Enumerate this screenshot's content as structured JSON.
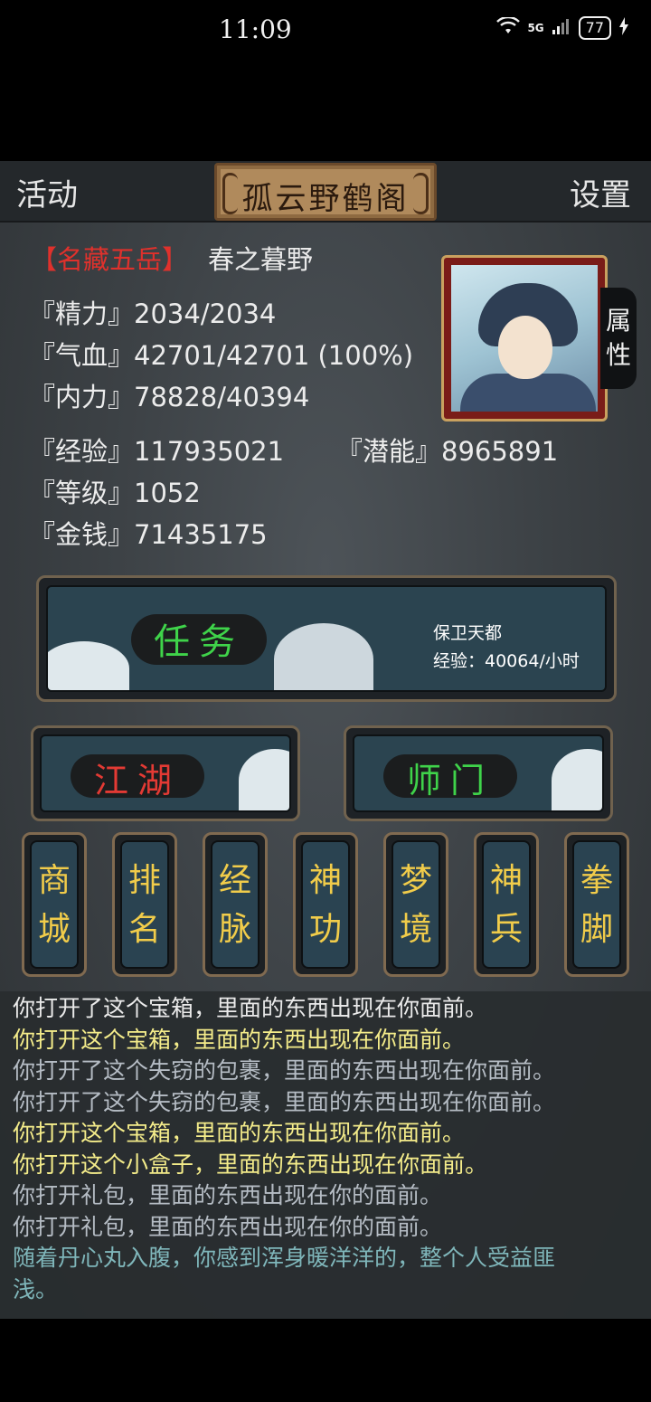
{
  "status_bar": {
    "time": "11:09",
    "network": "5G",
    "battery": "77"
  },
  "topbar": {
    "left_label": "活动",
    "title": "孤云野鹤阁",
    "right_label": "设置"
  },
  "character": {
    "title_tag": "【名藏五岳】",
    "name": "春之暮野",
    "attr_tab": [
      "属",
      "性"
    ]
  },
  "stats": {
    "jingli": "『精力』2034/2034",
    "qixue": "『气血』42701/42701 (100%)",
    "neili": "『内力』78828/40394",
    "jingyan": "『经验』117935021",
    "qianneng": "『潜能』8965891",
    "dengji": "『等级』1052",
    "jinqian": "『金钱』71435175"
  },
  "quest": {
    "label": "任务",
    "info_line1": "保卫天都",
    "info_line2": "经验：40064/小时"
  },
  "jianghu": {
    "label": "江湖"
  },
  "shimen": {
    "label": "师门"
  },
  "scroll_buttons": [
    {
      "top": "商",
      "bottom": "城"
    },
    {
      "top": "排",
      "bottom": "名"
    },
    {
      "top": "经",
      "bottom": "脉"
    },
    {
      "top": "神",
      "bottom": "功"
    },
    {
      "top": "梦",
      "bottom": "境"
    },
    {
      "top": "神",
      "bottom": "兵"
    },
    {
      "top": "拳",
      "bottom": "脚"
    }
  ],
  "log": [
    "你打开了这个宝箱，里面的东西出现在你面前。",
    "你打开这个宝箱，里面的东西出现在你面前。",
    "你打开了这个失窃的包裹，里面的东西出现在你面前。",
    "你打开了这个失窃的包裹，里面的东西出现在你面前。",
    "你打开这个宝箱，里面的东西出现在你面前。",
    "你打开这个小盒子，里面的东西出现在你面前。",
    "你打开礼包，里面的东西出现在你的面前。",
    "你打开礼包，里面的东西出现在你的面前。",
    "随着丹心丸入腹，你感到浑身暖洋洋的，整个人受益匪",
    "浅。"
  ],
  "colors": {
    "tag_red": "#e0312c",
    "quest_green": "#3fd34a",
    "jianghu_red": "#e33a34",
    "scroll_gold": "#f1cc4a"
  }
}
